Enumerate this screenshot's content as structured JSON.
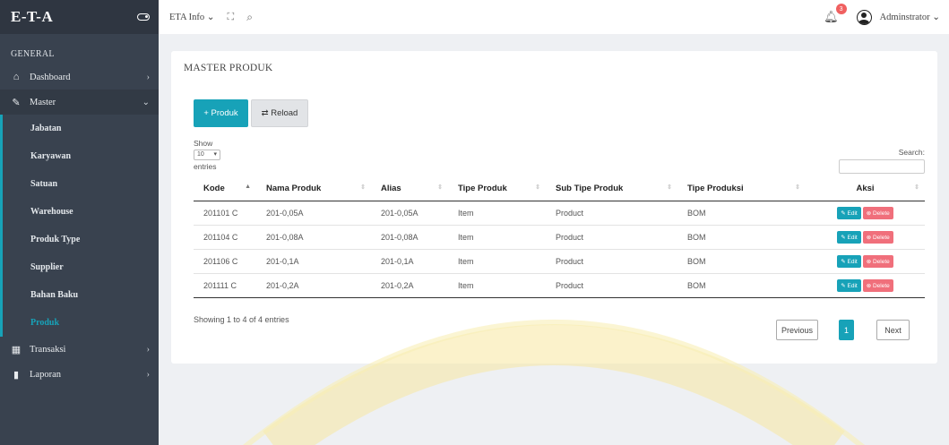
{
  "brand": {
    "title": "E-T-A",
    "toggle_icon": "toggle-icon"
  },
  "sidebar": {
    "section": "GENERAL",
    "items": [
      {
        "label": "Dashboard",
        "icon": "home-icon",
        "glyph": "⌂"
      },
      {
        "label": "Master",
        "icon": "edit-icon",
        "glyph": "✎"
      },
      {
        "label": "Transaksi",
        "icon": "grid-icon",
        "glyph": "▦"
      },
      {
        "label": "Laporan",
        "icon": "bar-chart-icon",
        "glyph": "▮"
      }
    ],
    "master_sub": [
      "Jabatan",
      "Karyawan",
      "Satuan",
      "Warehouse",
      "Produk Type",
      "Supplier",
      "Bahan Baku",
      "Produk"
    ]
  },
  "topbar": {
    "menu": "ETA Info ⌄",
    "expand_glyph": "⛶",
    "search_glyph": "⌕",
    "notif_count": "3",
    "user": "Adminstrator ⌄"
  },
  "page": {
    "title": "MASTER PRODUK",
    "add_button": "+ Produk",
    "reload_button": "⇄ Reload",
    "show_label": "Show",
    "entries_value": "10",
    "entries_label": "entries",
    "search_label": "Search:",
    "showing": "Showing 1 to 4 of 4 entries",
    "prev": "Previous",
    "page_num": "1",
    "next": "Next"
  },
  "table": {
    "headers": [
      "Kode",
      "Nama Produk",
      "Alias",
      "Tipe Produk",
      "Sub Tipe Produk",
      "Tipe Produksi",
      "Aksi"
    ],
    "rows": [
      [
        "201101 C",
        "201-0,05A",
        "201-0,05A",
        "Item",
        "Product",
        "BOM"
      ],
      [
        "201104 C",
        "201-0,08A",
        "201-0,08A",
        "Item",
        "Product",
        "BOM"
      ],
      [
        "201106 C",
        "201-0,1A",
        "201-0,1A",
        "Item",
        "Product",
        "BOM"
      ],
      [
        "201111 C",
        "201-0,2A",
        "201-0,2A",
        "Item",
        "Product",
        "BOM"
      ]
    ],
    "edit_label": "✎ Edit",
    "delete_label": "⊗ Delete"
  },
  "colors": {
    "accent": "#17a2b8",
    "sidebar": "#39424f",
    "danger": "#f06f7b"
  }
}
